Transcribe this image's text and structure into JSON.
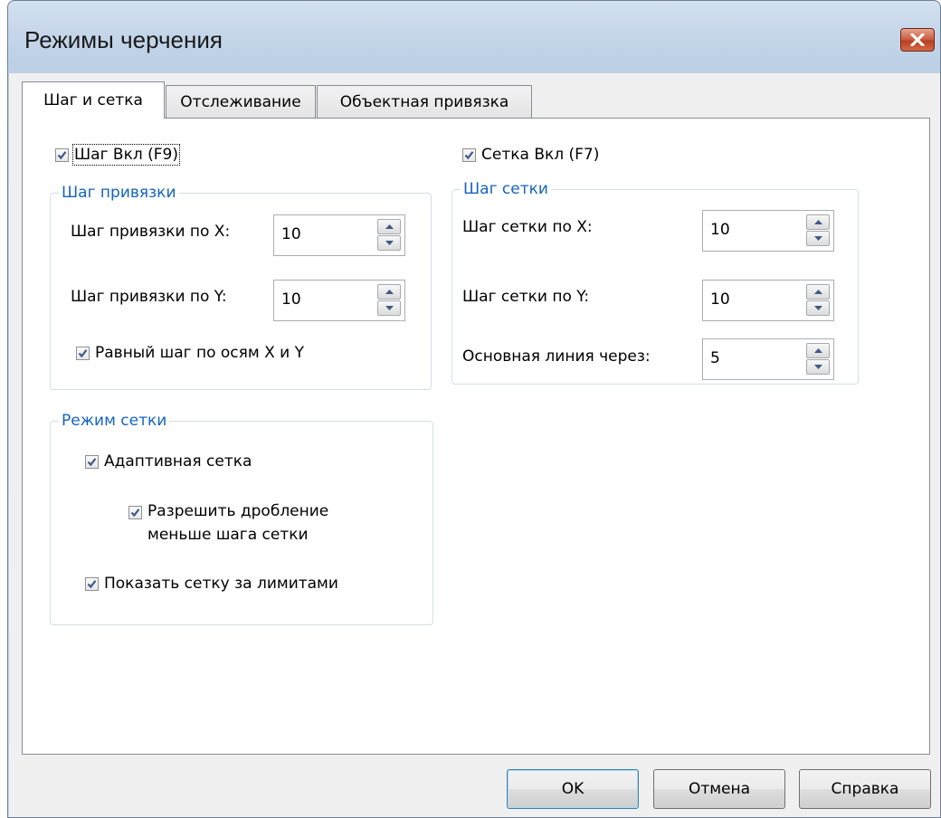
{
  "window": {
    "title": "Режимы черчения"
  },
  "tabs": [
    {
      "label": "Шаг и сетка",
      "active": true
    },
    {
      "label": "Отслеживание",
      "active": false
    },
    {
      "label": "Объектная привязка",
      "active": false
    }
  ],
  "snap_toggle": {
    "label": "Шаг Вкл (F9)",
    "checked": true
  },
  "grid_toggle": {
    "label": "Сетка Вкл (F7)",
    "checked": true
  },
  "snap_spacing": {
    "legend": "Шаг привязки",
    "x_label": "Шаг привязки по X:",
    "x_value": "10",
    "y_label": "Шаг привязки по Y:",
    "y_value": "10",
    "equal_label": "Равный шаг по осям X и Y",
    "equal_checked": true
  },
  "grid_spacing": {
    "legend": "Шаг сетки",
    "x_label": "Шаг сетки по X:",
    "x_value": "10",
    "y_label": "Шаг сетки по Y:",
    "y_value": "10",
    "major_label": "Основная линия через:",
    "major_value": "5"
  },
  "grid_mode": {
    "legend": "Режим сетки",
    "adaptive_label": "Адаптивная сетка",
    "adaptive_checked": true,
    "subdivide_label_line1": "Разрешить дробление",
    "subdivide_label_line2": "меньше шага сетки",
    "subdivide_checked": true,
    "beyond_limits_label": "Показать сетку за лимитами",
    "beyond_limits_checked": true
  },
  "buttons": {
    "ok": "OK",
    "cancel": "Отмена",
    "help": "Справка"
  },
  "icons": {
    "close": "close-icon",
    "check": "checkmark-icon",
    "spin_up": "spin-up-icon",
    "spin_down": "spin-down-icon"
  }
}
